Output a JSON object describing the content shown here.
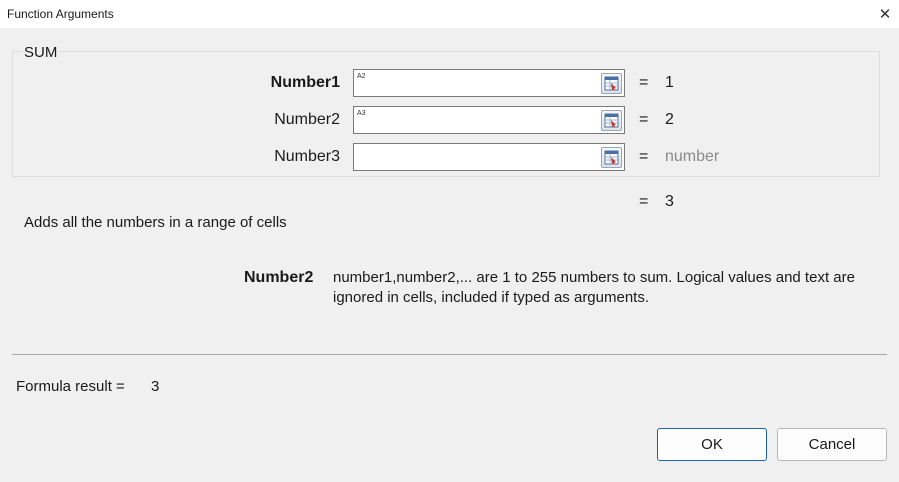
{
  "window": {
    "title": "Function Arguments",
    "close_glyph": "✕"
  },
  "function": {
    "name": "SUM",
    "args": [
      {
        "label": "Number1",
        "value": "A2",
        "result": "1",
        "bold": true
      },
      {
        "label": "Number2",
        "value": "A3",
        "result": "2",
        "bold": false
      },
      {
        "label": "Number3",
        "value": "",
        "result": "number",
        "bold": false
      }
    ],
    "equals": "=",
    "total_result": "3"
  },
  "description": "Adds all the numbers in a range of cells",
  "help": {
    "arg_name": "Number2",
    "text": "number1,number2,... are 1 to 255 numbers to sum. Logical values and text are ignored in cells, included if typed as arguments."
  },
  "formula_result": {
    "label": "Formula result =",
    "value": "3"
  },
  "buttons": {
    "ok": "OK",
    "cancel": "Cancel"
  },
  "icons": {
    "ref_button": "range-select-icon",
    "close": "close-icon"
  },
  "colors": {
    "primary_border": "#1f62b5",
    "hint_text": "#8a8a8a"
  }
}
